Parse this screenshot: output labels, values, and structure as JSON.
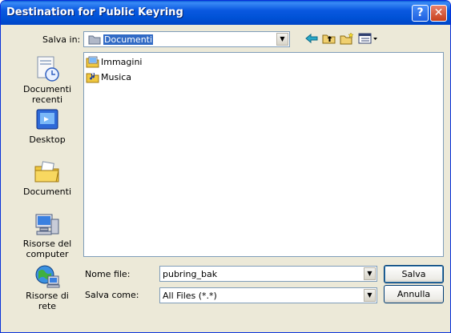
{
  "window": {
    "title": "Destination for Public Keyring"
  },
  "lookin": {
    "label": "Salva in:",
    "value": "Documenti"
  },
  "places": [
    {
      "id": "recent",
      "label": "Documenti recenti"
    },
    {
      "id": "desktop",
      "label": "Desktop"
    },
    {
      "id": "documents",
      "label": "Documenti"
    },
    {
      "id": "computer",
      "label": "Risorse del computer"
    },
    {
      "id": "network",
      "label": "Risorse di rete"
    }
  ],
  "files": [
    {
      "name": "Immagini"
    },
    {
      "name": "Musica"
    }
  ],
  "filename": {
    "label": "Nome file:",
    "value": "pubring_bak"
  },
  "filetype": {
    "label": "Salva come:",
    "value": "All Files (*.*)"
  },
  "buttons": {
    "save": "Salva",
    "cancel": "Annulla"
  },
  "colors": {
    "titlebar": "#0a58e0",
    "dialog_bg": "#ece9d8",
    "selection": "#316ac5"
  }
}
